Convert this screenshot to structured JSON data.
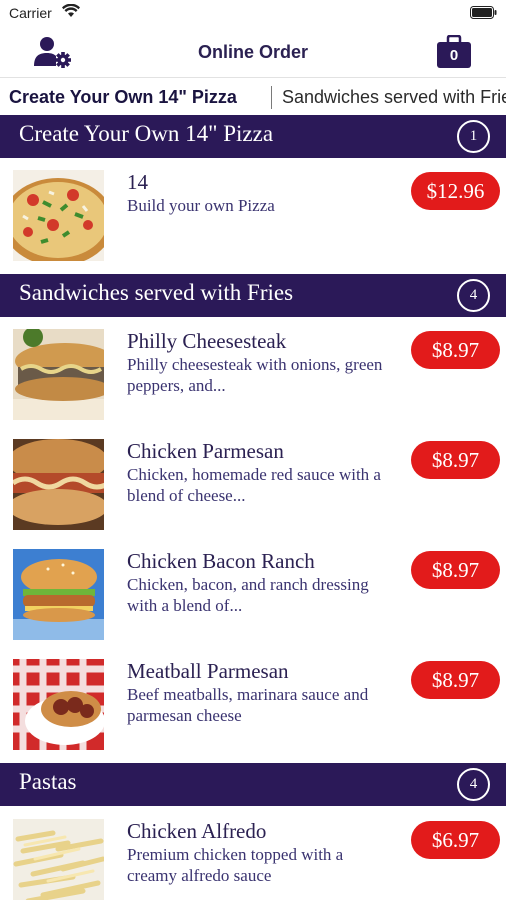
{
  "status_bar": {
    "carrier": "Carrier",
    "wifi_icon": "wifi-icon",
    "battery_icon": "battery-icon"
  },
  "nav": {
    "title": "Online Order",
    "account_icon": "user-settings-icon",
    "cart_icon": "shopping-bag-icon",
    "cart_count": "0"
  },
  "category_tabs": [
    {
      "label": "Create Your Own 14\" Pizza",
      "active": true
    },
    {
      "label": "Sandwiches served with Fries",
      "active": false
    }
  ],
  "colors": {
    "header_bg": "#2b1958",
    "price_bg": "#e21b1b",
    "text": "#2b2152"
  },
  "sections": [
    {
      "title": "Create Your Own 14\" Pizza",
      "count": "1",
      "items": [
        {
          "name": "14",
          "description": "Build your own Pizza",
          "price": "$12.96",
          "image": "pizza"
        }
      ]
    },
    {
      "title": "Sandwiches served with Fries",
      "count": "4",
      "items": [
        {
          "name": "Philly Cheesesteak",
          "description": "Philly cheesesteak with onions, green peppers, and...",
          "price": "$8.97",
          "image": "philly-cheesesteak"
        },
        {
          "name": "Chicken Parmesan",
          "description": "Chicken, homemade red sauce with a blend of cheese...",
          "price": "$8.97",
          "image": "chicken-parmesan"
        },
        {
          "name": "Chicken Bacon Ranch",
          "description": "Chicken, bacon, and ranch dressing with a blend of...",
          "price": "$8.97",
          "image": "chicken-bacon-ranch"
        },
        {
          "name": "Meatball Parmesan",
          "description": "Beef meatballs, marinara sauce and parmesan cheese",
          "price": "$8.97",
          "image": "meatball-sub"
        }
      ]
    },
    {
      "title": "Pastas",
      "count": "4",
      "items": [
        {
          "name": "Chicken Alfredo",
          "description": "Premium chicken topped with a creamy alfredo sauce",
          "price": "$6.97",
          "image": "chicken-alfredo"
        }
      ]
    }
  ]
}
